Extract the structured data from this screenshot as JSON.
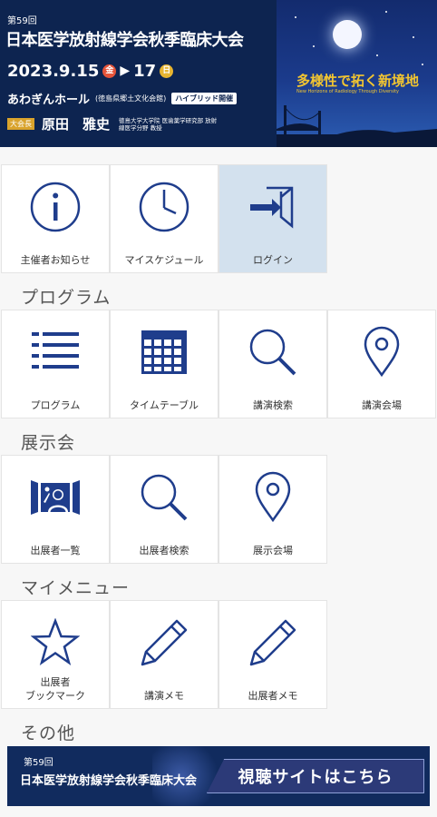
{
  "header": {
    "edition": "第59回",
    "title": "日本医学放射線学会秋季臨床大会",
    "date_start": "2023.9.15",
    "day_start": "金",
    "date_end": "17",
    "day_end": "日",
    "venue": "あわぎんホール",
    "venue_note": "(徳島県郷土文化会館)",
    "hybrid": "ハイブリッド開催",
    "chair_tag": "大会長",
    "chair_name": "原田　雅史",
    "chair_affiliation": "徳島大学大学院 医歯薬学研究部 放射線医学分野 教授",
    "slogan": "多様性で拓く新境地",
    "slogan_en": "New Horizons of Radiology Through Diversity"
  },
  "colors": {
    "navy": "#0d2450",
    "icon": "#1f3d8c",
    "active_tile": "#d3e1ee",
    "accent_gold": "#f2c531"
  },
  "top_tiles": [
    {
      "label": "主催者お知らせ",
      "icon": "info-icon"
    },
    {
      "label": "マイスケジュール",
      "icon": "clock-icon"
    },
    {
      "label": "ログイン",
      "icon": "login-icon"
    }
  ],
  "sections": {
    "program": {
      "title": "プログラム",
      "tiles": [
        {
          "label": "プログラム",
          "icon": "list-icon"
        },
        {
          "label": "タイムテーブル",
          "icon": "calendar-icon"
        },
        {
          "label": "講演検索",
          "icon": "search-icon"
        },
        {
          "label": "講演会場",
          "icon": "location-pin-icon"
        }
      ]
    },
    "exhibition": {
      "title": "展示会",
      "tiles": [
        {
          "label": "出展者一覧",
          "icon": "exhibitor-icon"
        },
        {
          "label": "出展者検索",
          "icon": "search-icon"
        },
        {
          "label": "展示会場",
          "icon": "location-pin-icon"
        }
      ]
    },
    "mymenu": {
      "title": "マイメニュー",
      "tiles": [
        {
          "label_line1": "出展者",
          "label_line2": "ブックマーク",
          "icon": "star-icon"
        },
        {
          "label": "講演メモ",
          "icon": "pencil-icon"
        },
        {
          "label": "出展者メモ",
          "icon": "pencil-icon"
        }
      ]
    },
    "other": {
      "title": "その他"
    }
  },
  "bottom_banner": {
    "edition": "第59回",
    "title": "日本医学放射線学会秋季臨床大会",
    "cta": "視聴サイトはこちら"
  }
}
